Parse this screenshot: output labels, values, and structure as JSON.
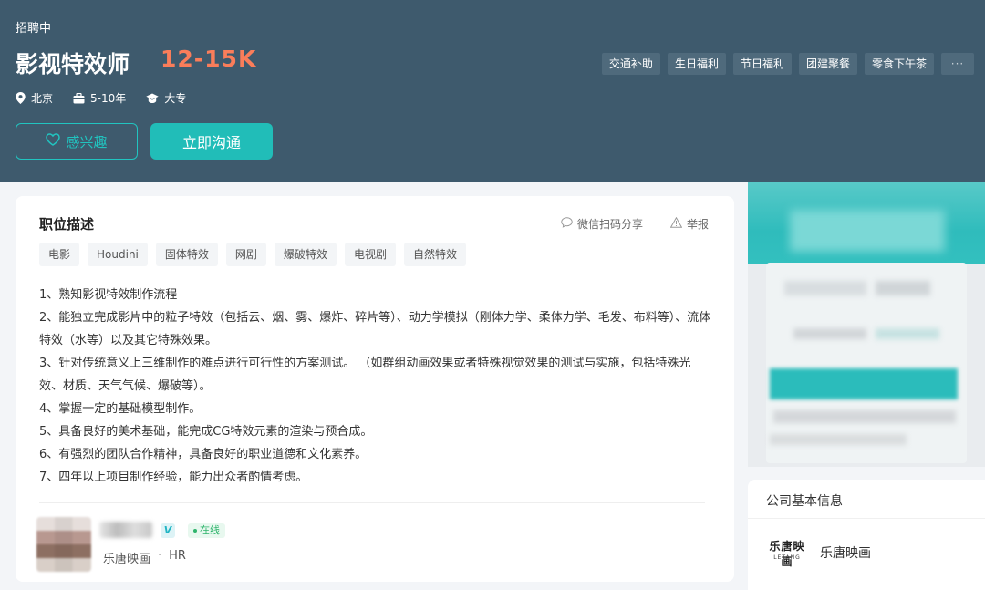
{
  "header": {
    "status": "招聘中",
    "job_title": "影视特效师",
    "salary": "12-15K",
    "meta": {
      "location": "北京",
      "experience": "5-10年",
      "education": "大专"
    },
    "welfare": [
      "交通补助",
      "生日福利",
      "节日福利",
      "团建聚餐",
      "零食下午茶"
    ],
    "welfare_more": "···",
    "btn_interest": "感兴趣",
    "btn_chat": "立即沟通"
  },
  "description": {
    "title": "职位描述",
    "share": "微信扫码分享",
    "report": "举报",
    "skills": [
      "电影",
      "Houdini",
      "固体特效",
      "网剧",
      "爆破特效",
      "电视剧",
      "自然特效"
    ],
    "lines": [
      "1、熟知影视特效制作流程",
      "2、能独立完成影片中的粒子特效（包括云、烟、雾、爆炸、碎片等）、动力学模拟（刚体力学、柔体力学、毛发、布料等）、流体特效（水等）以及其它特殊效果。",
      "3、针对传统意义上三维制作的难点进行可行性的方案测试。 （如群组动画效果或者特殊视觉效果的测试与实施，包括特殊光效、材质、天气气候、爆破等）。",
      "4、掌握一定的基础模型制作。",
      "5、具备良好的美术基础，能完成CG特效元素的渲染与预合成。",
      "6、有强烈的团队合作精神，具备良好的职业道德和文化素养。",
      "7、四年以上项目制作经验，能力出众者酌情考虑。"
    ]
  },
  "recruiter": {
    "verified": "V",
    "online": "在线",
    "company": "乐唐映画",
    "sep": "·",
    "role": "HR"
  },
  "company_info": {
    "title": "公司基本信息",
    "logo_cn": "乐唐映画",
    "logo_en": "LETANG",
    "name": "乐唐映画"
  },
  "colors": {
    "header_bg": "#3e5a6d",
    "accent": "#21bdb8",
    "salary": "#fa7d5a",
    "online": "#2fb46c"
  }
}
